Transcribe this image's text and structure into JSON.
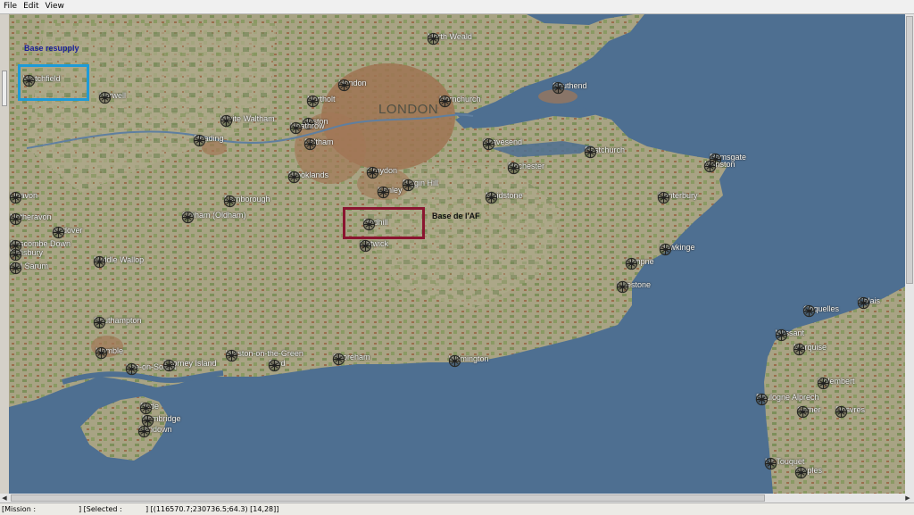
{
  "menu": {
    "items": [
      "File",
      "Edit",
      "View"
    ]
  },
  "map": {
    "region_label": "LONDON",
    "annotations": {
      "resupply": {
        "text": "Base resupply",
        "color": "#1a1e9a"
      },
      "af_base": {
        "text": "Base de l'AF",
        "color": "#111111"
      }
    },
    "highlight_colors": {
      "resupply_box": "#1e9bd7",
      "af_box": "#8a1530"
    },
    "airfields": [
      "North Weald",
      "Watchfield",
      "Harwell",
      "Hendon",
      "Northolt",
      "Hornchurch",
      "Southend",
      "White Waltham",
      "Heston",
      "Heathrow",
      "Feltham",
      "Reading",
      "Gravesend",
      "Eastchurch",
      "Rochester",
      "Ramsgate",
      "Manston",
      "Croydon",
      "Biggin Hill",
      "Kenley",
      "Brooklands",
      "Farnborough",
      "Maidstone",
      "Canterbury",
      "Odiham (Oldham)",
      "Redhill",
      "Andover",
      "Upavon",
      "Netheravon",
      "Boscombe Down",
      "Salisbury",
      "Old Sarum",
      "Middle Wallop",
      "Gatwick",
      "Hawkinge",
      "Lympne",
      "Lillestone",
      "Southampton",
      "Hamble",
      "Weston-on-the-Green",
      "Lee-on-Solent",
      "Thorney Island",
      "Ford",
      "Shoreham",
      "Wilmington",
      "Ryde",
      "Bembridge",
      "Sandown",
      "Coquelles",
      "Wissant",
      "Marquise",
      "Colembert",
      "Boulogne Alprech",
      "Samer",
      "Desvres",
      "Le Touquet",
      "Etaples",
      "Calais"
    ]
  },
  "status": {
    "mission": "[Mission :",
    "selected": "] [Selected :",
    "coords": "] [(116570.7;230736.5;64.3) [14,28]]"
  }
}
